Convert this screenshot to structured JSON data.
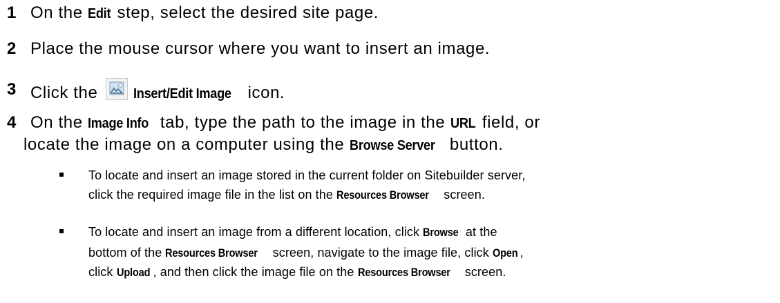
{
  "steps": [
    {
      "number": "1",
      "text": {
        "a": "On the ",
        "b": "Edit",
        "c": " step, select the desired site page."
      }
    },
    {
      "number": "2",
      "text": {
        "a": "Place the mouse cursor where you want to insert an image."
      }
    },
    {
      "number": "3",
      "text": {
        "a": "Click the ",
        "b": "Insert/Edit Image",
        "c": " icon."
      },
      "icon": "insert-image-icon"
    },
    {
      "number": "4",
      "line1": {
        "a": "On the ",
        "b": "Image Info",
        "c": " tab, type the path to the image in the ",
        "d": "URL",
        "e": " field, or"
      },
      "line2": {
        "a": "locate the image on a computer using the ",
        "b": "Browse Server",
        "c": " button."
      }
    }
  ],
  "bullets": [
    {
      "line1": "To locate and insert an image stored in the current folder on Sitebuilder server,",
      "line2": {
        "a": "click the required image file in the list on the ",
        "b": "Resources Browser",
        "c": " screen."
      }
    },
    {
      "line1": {
        "a": "To locate and insert an image from a different location, click ",
        "b": "Browse",
        "c": " at the"
      },
      "line2": {
        "a": "bottom of the ",
        "b": "Resources Browser",
        "c": " screen, navigate to the image file, click ",
        "d": "Open",
        "e": ","
      },
      "line3": {
        "a": "click ",
        "b": "Upload",
        "c": ", and then click the image file on the ",
        "d": "Resources Browser",
        "e": " screen."
      }
    }
  ],
  "colors": {
    "text": "#000000",
    "background": "#ffffff",
    "icon_frame": "#8a9bb0",
    "icon_sky": "#cfe3f5"
  }
}
